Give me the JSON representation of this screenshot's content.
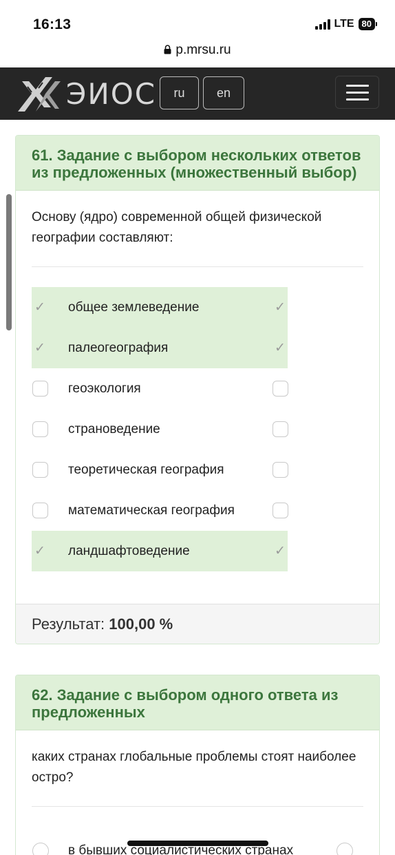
{
  "status_bar": {
    "time": "16:13",
    "network": "LTE",
    "battery": "80"
  },
  "browser": {
    "url": "p.mrsu.ru"
  },
  "navbar": {
    "logo_text": "ЭИОС",
    "lang_ru": "ru",
    "lang_en": "en"
  },
  "question_61": {
    "title": "61. Задание с выбором нескольких ответов из предложенных (множественный выбор)",
    "text": "Основу (ядро) современной общей физической географии составляют:",
    "options": [
      {
        "label": "общее землеведение",
        "correct": true
      },
      {
        "label": "палеогеография",
        "correct": true
      },
      {
        "label": "геоэкология",
        "correct": false
      },
      {
        "label": "страноведение",
        "correct": false
      },
      {
        "label": "теоретическая география",
        "correct": false
      },
      {
        "label": "математическая география",
        "correct": false
      },
      {
        "label": "ландшафтоведение",
        "correct": true
      }
    ],
    "result_label": "Результат:",
    "result_value": "100,00 %"
  },
  "question_62": {
    "title": "62. Задание с выбором одного ответа из предложенных",
    "text": "каких странах глобальные проблемы стоят наиболее остро?",
    "options": [
      {
        "label": "в бывших социалистических странах"
      }
    ]
  },
  "icons": {
    "check": "✓"
  },
  "colors": {
    "correct_bg": "#dff0d8",
    "header_text": "#3c763d",
    "navbar_bg": "#262626"
  }
}
